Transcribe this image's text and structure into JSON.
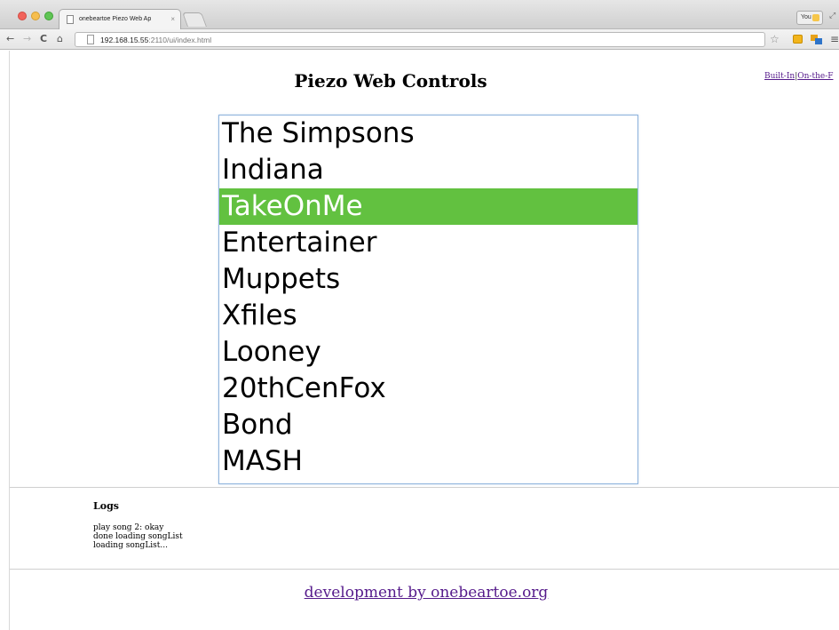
{
  "browser": {
    "tab_title": "onebeartoe Piezo Web Ap",
    "tab_close": "×",
    "url_host": "192.168.15.55",
    "url_path": ":2110/ui/index.html",
    "profile_label": "You",
    "back_glyph": "←",
    "forward_glyph": "→",
    "reload_glyph": "C",
    "home_glyph": "⌂",
    "star_glyph": "☆",
    "menu_glyph": "≡",
    "resize_glyph": "⤢",
    "colors": {
      "close": "#f2635b",
      "minimize": "#f6be4f",
      "maximize": "#5fc454"
    }
  },
  "page": {
    "title": "Piezo Web Controls",
    "nav_links": [
      {
        "label": "Built-In"
      },
      {
        "label": "On-the-F"
      }
    ],
    "nav_separator": "|",
    "songs": [
      {
        "label": "The Simpsons",
        "selected": false
      },
      {
        "label": "Indiana",
        "selected": false
      },
      {
        "label": "TakeOnMe",
        "selected": true
      },
      {
        "label": "Entertainer",
        "selected": false
      },
      {
        "label": "Muppets",
        "selected": false
      },
      {
        "label": "Xfiles",
        "selected": false
      },
      {
        "label": "Looney",
        "selected": false
      },
      {
        "label": "20thCenFox",
        "selected": false
      },
      {
        "label": "Bond",
        "selected": false
      },
      {
        "label": "MASH",
        "selected": false
      }
    ],
    "selection_color": "#62c140",
    "logs": {
      "heading": "Logs",
      "lines": [
        "play song 2: okay",
        "done loading songList",
        "loading songList..."
      ]
    },
    "footer_link": "development by onebeartoe.org"
  }
}
